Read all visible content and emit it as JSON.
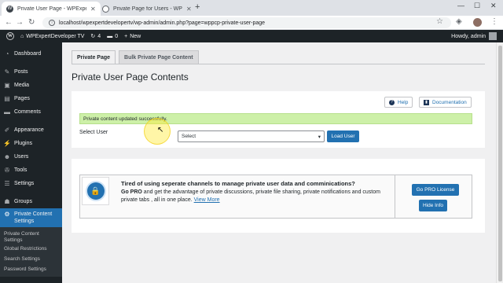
{
  "browser": {
    "tabs": [
      {
        "title": "Private User Page - WPExpertDev",
        "active": true
      },
      {
        "title": "Private Page for Users - WP Exp",
        "active": false
      }
    ],
    "url": "localhost/wpexpertdevelopertv/wp-admin/admin.php?page=wppcp-private-user-page"
  },
  "adminbar": {
    "site_name": "WPExpertDeveloper TV",
    "updates_count": "4",
    "comments_count": "0",
    "new_label": "New",
    "howdy": "Howdy, admin"
  },
  "sidebar": {
    "items": [
      {
        "label": "Dashboard",
        "icon": "gauge-icon"
      },
      {
        "label": "Posts",
        "icon": "pin-icon"
      },
      {
        "label": "Media",
        "icon": "media-icon"
      },
      {
        "label": "Pages",
        "icon": "pages-icon"
      },
      {
        "label": "Comments",
        "icon": "comment-icon"
      },
      {
        "label": "Appearance",
        "icon": "brush-icon"
      },
      {
        "label": "Plugins",
        "icon": "plug-icon"
      },
      {
        "label": "Users",
        "icon": "users-icon"
      },
      {
        "label": "Tools",
        "icon": "wrench-icon"
      },
      {
        "label": "Settings",
        "icon": "sliders-icon"
      },
      {
        "label": "Groups",
        "icon": "groups-icon"
      }
    ],
    "current": {
      "label_line1": "Private Content",
      "label_line2": "Settings",
      "icon": "gear-icon"
    },
    "submenu": [
      {
        "line1": "Private Content",
        "line2": "Settings"
      },
      {
        "line1": "Global Restrictions"
      },
      {
        "line1": "Search Settings"
      },
      {
        "line1": "Password Settings"
      }
    ]
  },
  "main": {
    "tabs": [
      "Private Page",
      "Bulk Private Page Content"
    ],
    "title": "Private User Page Contents",
    "help_label": "Help",
    "docs_label": "Documentation",
    "notice": "Private content updated successfully.",
    "select_label": "Select User",
    "select_value": "Select",
    "load_button": "Load User",
    "promo": {
      "title": "Tired of using seperate channels to manage private user data and comminications?",
      "go_pro": "Go PRO",
      "text": "and get the advantage of private discussions, private file sharing, private notifications and custom private tabs , all in one place.",
      "link": "View More",
      "license_button": "Go PRO License",
      "hide_button": "Hide Info"
    }
  },
  "colors": {
    "wp_dark": "#1d2327",
    "wp_blue": "#2271b1",
    "notice_green": "#cdf0a8"
  }
}
